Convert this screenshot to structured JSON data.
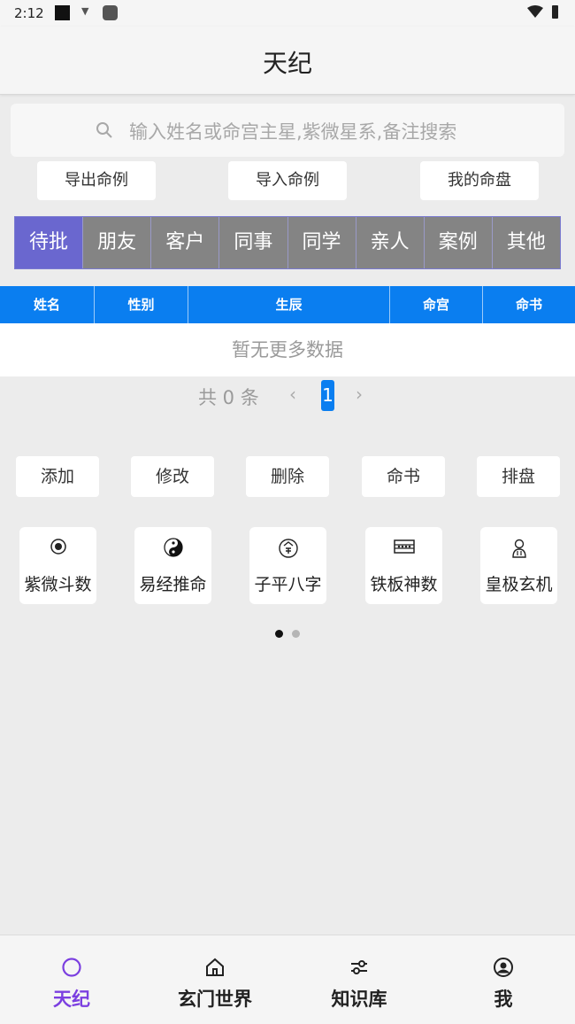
{
  "status_bar": {
    "time": "2:12"
  },
  "app_bar": {
    "title": "天纪"
  },
  "search": {
    "placeholder": "输入姓名或命宫主星,紫微星系,备注搜索"
  },
  "actions": [
    {
      "label": "导出命例"
    },
    {
      "label": "导入命例"
    },
    {
      "label": "我的命盘"
    }
  ],
  "tabs": [
    {
      "label": "待批",
      "active": true
    },
    {
      "label": "朋友"
    },
    {
      "label": "客户"
    },
    {
      "label": "同事"
    },
    {
      "label": "同学"
    },
    {
      "label": "亲人"
    },
    {
      "label": "案例"
    },
    {
      "label": "其他"
    }
  ],
  "table": {
    "columns": [
      "姓名",
      "性别",
      "生辰",
      "命宫",
      "命书"
    ],
    "empty_text": "暂无更多数据"
  },
  "pagination": {
    "total": "共 0 条",
    "current_page": "1",
    "prev": "‹",
    "next": "›"
  },
  "operations": [
    {
      "label": "添加"
    },
    {
      "label": "修改"
    },
    {
      "label": "删除"
    },
    {
      "label": "命书"
    },
    {
      "label": "排盘"
    }
  ],
  "modules": [
    {
      "label": "紫微斗数",
      "icon": "star-disc-icon"
    },
    {
      "label": "易经推命",
      "icon": "yin-yang-icon"
    },
    {
      "label": "子平八字",
      "icon": "bazi-seal-icon"
    },
    {
      "label": "铁板神数",
      "icon": "abacus-icon"
    },
    {
      "label": "皇极玄机",
      "icon": "sage-figure-icon"
    }
  ],
  "carousel": {
    "pages": 2,
    "active_index": 0
  },
  "bottom_nav": [
    {
      "label": "天纪",
      "icon": "circle-icon",
      "active": true
    },
    {
      "label": "玄门世界",
      "icon": "home-icon"
    },
    {
      "label": "知识库",
      "icon": "sliders-icon"
    },
    {
      "label": "我",
      "icon": "user-circle-icon"
    }
  ],
  "colors": {
    "accent_purple": "#6a67cf",
    "nav_active": "#7b3fe0",
    "table_header": "#0a7ef0",
    "tab_inactive": "#848484",
    "background": "#ececec"
  }
}
